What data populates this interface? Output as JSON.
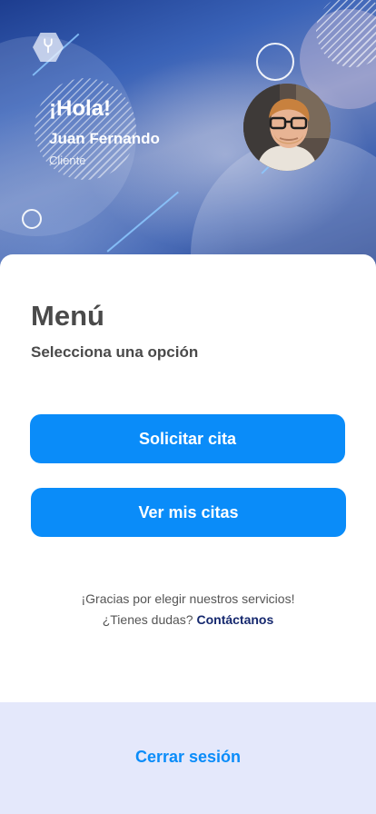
{
  "header": {
    "greeting": "¡Hola!",
    "user_name": "Juan Fernando",
    "user_role": "Cliente",
    "logo_icon": "wrench-icon",
    "avatar": "user-avatar-photo"
  },
  "menu": {
    "title": "Menú",
    "subtitle": "Selecciona una opción",
    "buttons": [
      {
        "label": "Solicitar cita"
      },
      {
        "label": "Ver mis citas"
      }
    ]
  },
  "footer_note": {
    "thanks": "¡Gracias por elegir nuestros servicios!",
    "question": "¿Tienes dudas?",
    "contact_link": "Contáctanos"
  },
  "logout": {
    "label": "Cerrar sesión"
  },
  "colors": {
    "primary": "#0a8cf9",
    "link": "#15286e",
    "footer_bg": "#e4e8fb"
  }
}
